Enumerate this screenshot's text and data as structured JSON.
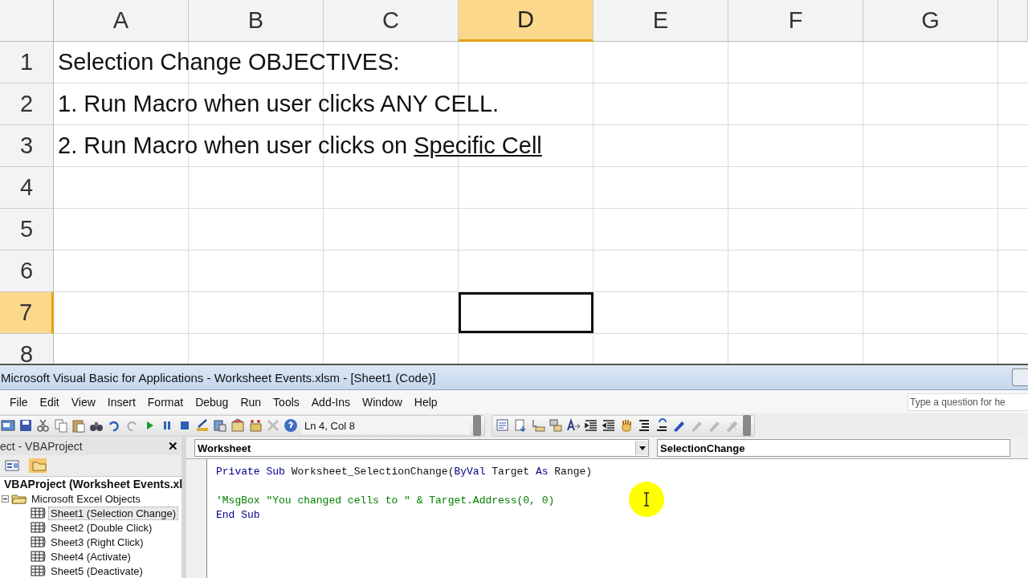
{
  "sheet": {
    "columns": [
      {
        "label": "A",
        "selected": false
      },
      {
        "label": "B",
        "selected": false
      },
      {
        "label": "C",
        "selected": false
      },
      {
        "label": "D",
        "selected": true
      },
      {
        "label": "E",
        "selected": false
      },
      {
        "label": "F",
        "selected": false
      },
      {
        "label": "G",
        "selected": false
      }
    ],
    "rows": [
      {
        "label": "1",
        "selected": false,
        "content": [
          {
            "text": "Selection Change OBJECTIVES:",
            "underline": false
          }
        ]
      },
      {
        "label": "2",
        "selected": false,
        "content": [
          {
            "text": "1. Run Macro when user clicks ANY CELL.",
            "underline": false
          }
        ]
      },
      {
        "label": "3",
        "selected": false,
        "content": [
          {
            "text": "2. Run Macro when user clicks on ",
            "underline": false
          },
          {
            "text": "Specific Cell",
            "underline": true
          }
        ]
      },
      {
        "label": "4",
        "selected": false
      },
      {
        "label": "5",
        "selected": false
      },
      {
        "label": "6",
        "selected": false
      },
      {
        "label": "7",
        "selected": true
      },
      {
        "label": "8",
        "selected": false
      }
    ]
  },
  "vbe": {
    "window": {
      "title": "Microsoft Visual Basic for Applications - Worksheet Events.xlsm - [Sheet1 (Code)]"
    },
    "menu": [
      "File",
      "Edit",
      "View",
      "Insert",
      "Format",
      "Debug",
      "Run",
      "Tools",
      "Add-Ins",
      "Window",
      "Help"
    ],
    "help_box": {
      "placeholder": "Type a question for he"
    },
    "position": "Ln 4, Col 8",
    "project_pane": {
      "title": "ect - VBAProject",
      "close_label": "✕",
      "tree": [
        {
          "label": "VBAProject (Worksheet Events.xl",
          "kind": "project",
          "selected": false,
          "children": [
            {
              "label": "Microsoft Excel Objects",
              "kind": "folder",
              "expanded": true,
              "selected": false,
              "children": [
                {
                  "label": "Sheet1 (Selection Change)",
                  "kind": "sheet",
                  "selected": true
                },
                {
                  "label": "Sheet2 (Double Click)",
                  "kind": "sheet",
                  "selected": false
                },
                {
                  "label": "Sheet3 (Right Click)",
                  "kind": "sheet",
                  "selected": false
                },
                {
                  "label": "Sheet4 (Activate)",
                  "kind": "sheet",
                  "selected": false
                },
                {
                  "label": "Sheet5 (Deactivate)",
                  "kind": "sheet",
                  "selected": false
                }
              ]
            }
          ]
        }
      ]
    },
    "code_pane": {
      "object": "Worksheet",
      "procedure": "SelectionChange",
      "lines": [
        {
          "kind": "code",
          "segments": [
            {
              "kind": "keyword",
              "text": "Private Sub "
            },
            {
              "kind": "plain",
              "text": "Worksheet_SelectionChange("
            },
            {
              "kind": "keyword",
              "text": "ByVal "
            },
            {
              "kind": "plain",
              "text": "Target "
            },
            {
              "kind": "keyword",
              "text": "As "
            },
            {
              "kind": "plain",
              "text": "Range)"
            }
          ]
        },
        {
          "kind": "blank"
        },
        {
          "kind": "code",
          "segments": [
            {
              "kind": "comment",
              "text": "'MsgBox \"You changed cells to \" & Target.Address(0, 0)"
            }
          ]
        },
        {
          "kind": "code",
          "segments": [
            {
              "kind": "keyword",
              "text": "End Sub"
            }
          ]
        }
      ]
    }
  }
}
